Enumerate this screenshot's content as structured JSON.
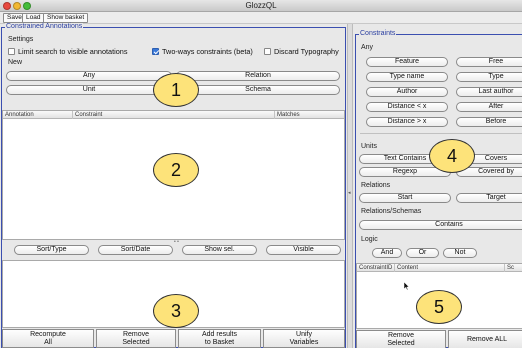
{
  "window": {
    "title": "GlozzQL"
  },
  "toolbar": {
    "save": "Save",
    "load": "Load",
    "show_basket": "Show basket"
  },
  "left_panel": {
    "legend": "Constrained Annotations",
    "settings_label": "Settings",
    "settings": {
      "limit_search": {
        "label": "Limit search to visible annotations",
        "checked": false
      },
      "two_ways": {
        "label": "Two-ways constraints (beta)",
        "checked": true
      },
      "discard_typography": {
        "label": "Discard Typography",
        "checked": false
      }
    },
    "new_label": "New",
    "new_buttons": {
      "any": "Any",
      "relation": "Relation",
      "unit": "Unit",
      "schema": "Schema"
    },
    "table": {
      "columns": [
        "Annotation",
        "Constraint",
        "Matches"
      ]
    },
    "sort_buttons": {
      "sort_type": "Sort/Type",
      "sort_date": "Sort/Date",
      "show_sel": "Show sel.",
      "visible": "Visible"
    },
    "bottom_buttons": {
      "recompute": [
        "Recompute",
        "All"
      ],
      "remove": [
        "Remove",
        "Selected"
      ],
      "add_results": [
        "Add results",
        "to Basket"
      ],
      "unify": [
        "Unify",
        "Variables"
      ]
    }
  },
  "right_panel": {
    "legend": "Constraints",
    "any_label": "Any",
    "any_buttons": {
      "feature": "Feature",
      "free": "Free",
      "type_name": "Type name",
      "type": "Type",
      "author": "Author",
      "last_author": "Last author",
      "distance_lt": "Distance < x",
      "after": "After",
      "distance_gt": "Distance > x",
      "before": "Before"
    },
    "units_label": "Units",
    "units_buttons": {
      "text_contains": "Text Contains",
      "covers": "Covers",
      "regexp": "Regexp",
      "covered_by": "Covered by"
    },
    "relations_label": "Relations",
    "relations_buttons": {
      "start": "Start",
      "target": "Target"
    },
    "relations_schemas_label": "Relations/Schemas",
    "contains": "Contains",
    "logic_label": "Logic",
    "logic_buttons": {
      "and": "And",
      "or": "Or",
      "not": "Not"
    },
    "table": {
      "columns": [
        "ConstraintID",
        "Content",
        "Sc"
      ]
    },
    "bottom_buttons": {
      "remove": [
        "Remove",
        "Selected"
      ],
      "remove_all": "Remove ALL"
    }
  },
  "callouts": {
    "one": "1",
    "two": "2",
    "three": "3",
    "four": "4",
    "five": "5"
  },
  "colors": {
    "panel_border": "#3b4fb0",
    "callout_fill": "#fde37a"
  }
}
